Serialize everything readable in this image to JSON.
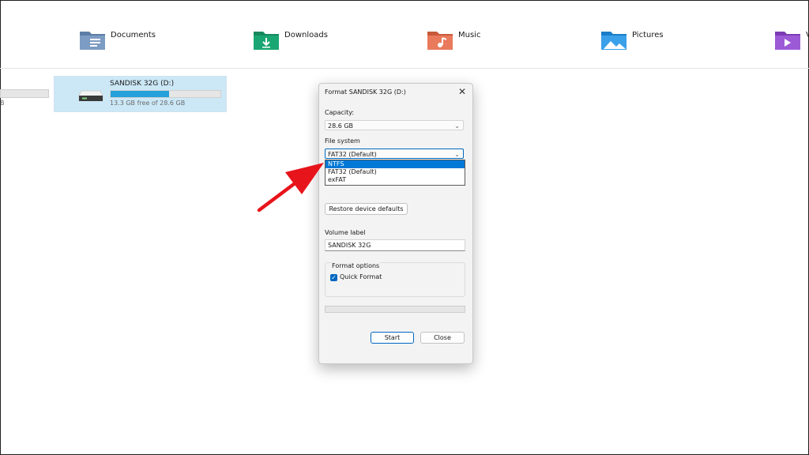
{
  "quick_access": [
    {
      "label": "Documents",
      "icon": "documents-folder-icon"
    },
    {
      "label": "Downloads",
      "icon": "downloads-folder-icon"
    },
    {
      "label": "Music",
      "icon": "music-folder-icon"
    },
    {
      "label": "Pictures",
      "icon": "pictures-folder-icon"
    },
    {
      "label": "V",
      "icon": "videos-folder-icon"
    }
  ],
  "drives": {
    "partial_suffix": "B",
    "sandisk": {
      "name": "SANDISK 32G (D:)",
      "free_text": "13.3 GB free of 28.6 GB",
      "used_fraction": 0.535
    }
  },
  "dialog": {
    "title": "Format SANDISK 32G (D:)",
    "close_glyph": "✕",
    "capacity_label": "Capacity:",
    "capacity_value": "28.6 GB",
    "filesystem_label": "File system",
    "filesystem_value": "FAT32 (Default)",
    "filesystem_options": [
      "NTFS",
      "FAT32 (Default)",
      "exFAT"
    ],
    "filesystem_selected_index": 0,
    "restore_button": "Restore device defaults",
    "volume_label_label": "Volume label",
    "volume_label_value": "SANDISK 32G",
    "format_options_label": "Format options",
    "quick_format_label": "Quick Format",
    "quick_format_checked": true,
    "start_button": "Start",
    "close_button": "Close"
  },
  "colors": {
    "accent": "#0067c0",
    "selection": "#0078d7",
    "drive_bar": "#26a0da",
    "annotation_arrow": "#e8141b"
  }
}
